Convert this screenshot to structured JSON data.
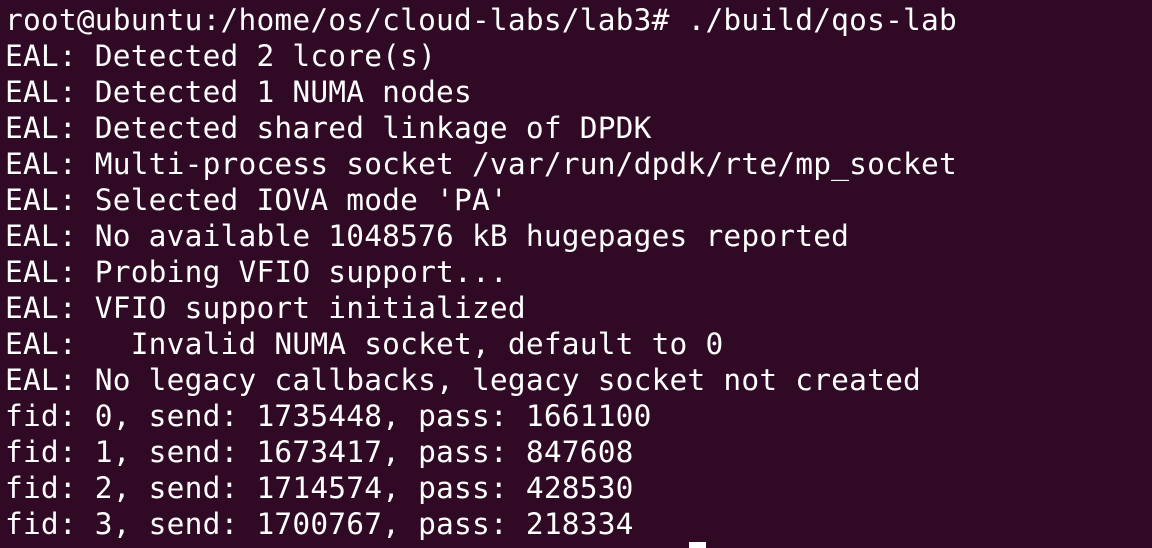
{
  "window": {
    "background_color": "#300a24",
    "text_color": "#ffffff"
  },
  "terminal": {
    "clipped_previous_line": "                    /",
    "lines": [
      "root@ubuntu:/home/os/cloud-labs/lab3# ./build/qos-lab",
      "EAL: Detected 2 lcore(s)",
      "EAL: Detected 1 NUMA nodes",
      "EAL: Detected shared linkage of DPDK",
      "EAL: Multi-process socket /var/run/dpdk/rte/mp_socket",
      "EAL: Selected IOVA mode 'PA'",
      "EAL: No available 1048576 kB hugepages reported",
      "EAL: Probing VFIO support...",
      "EAL: VFIO support initialized",
      "EAL:   Invalid NUMA socket, default to 0",
      "EAL: No legacy callbacks, legacy socket not created",
      "fid: 0, send: 1735448, pass: 1661100",
      "fid: 1, send: 1673417, pass: 847608",
      "fid: 2, send: 1714574, pass: 428530",
      "fid: 3, send: 1700767, pass: 218334"
    ]
  }
}
